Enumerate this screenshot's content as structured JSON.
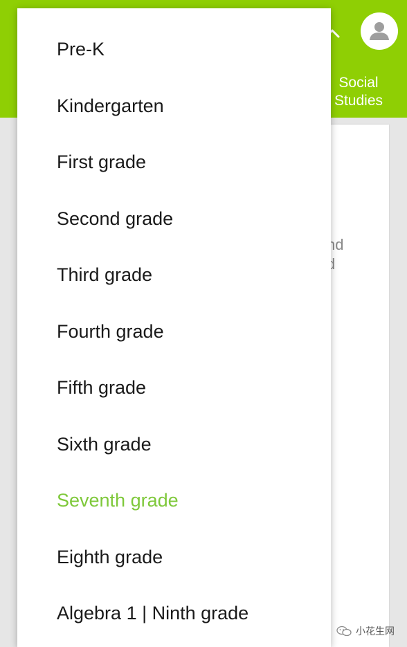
{
  "header": {
    "subject_tab_label": "Social Studies"
  },
  "content": {
    "partial_text": "nd\nd"
  },
  "grade_menu": {
    "items": [
      {
        "label": "Pre-K",
        "selected": false
      },
      {
        "label": "Kindergarten",
        "selected": false
      },
      {
        "label": "First grade",
        "selected": false
      },
      {
        "label": "Second grade",
        "selected": false
      },
      {
        "label": "Third grade",
        "selected": false
      },
      {
        "label": "Fourth grade",
        "selected": false
      },
      {
        "label": "Fifth grade",
        "selected": false
      },
      {
        "label": "Sixth grade",
        "selected": false
      },
      {
        "label": "Seventh grade",
        "selected": true
      },
      {
        "label": "Eighth grade",
        "selected": false
      },
      {
        "label": "Algebra 1  |  Ninth grade",
        "selected": false
      }
    ]
  },
  "watermark": {
    "text": "小花生网",
    "icon": "wechat-icon"
  },
  "colors": {
    "appbar": "#8fcf04",
    "selected_item": "#7ec83a"
  },
  "icons": {
    "account": "account-icon",
    "collapse": "chevron-up-icon"
  }
}
